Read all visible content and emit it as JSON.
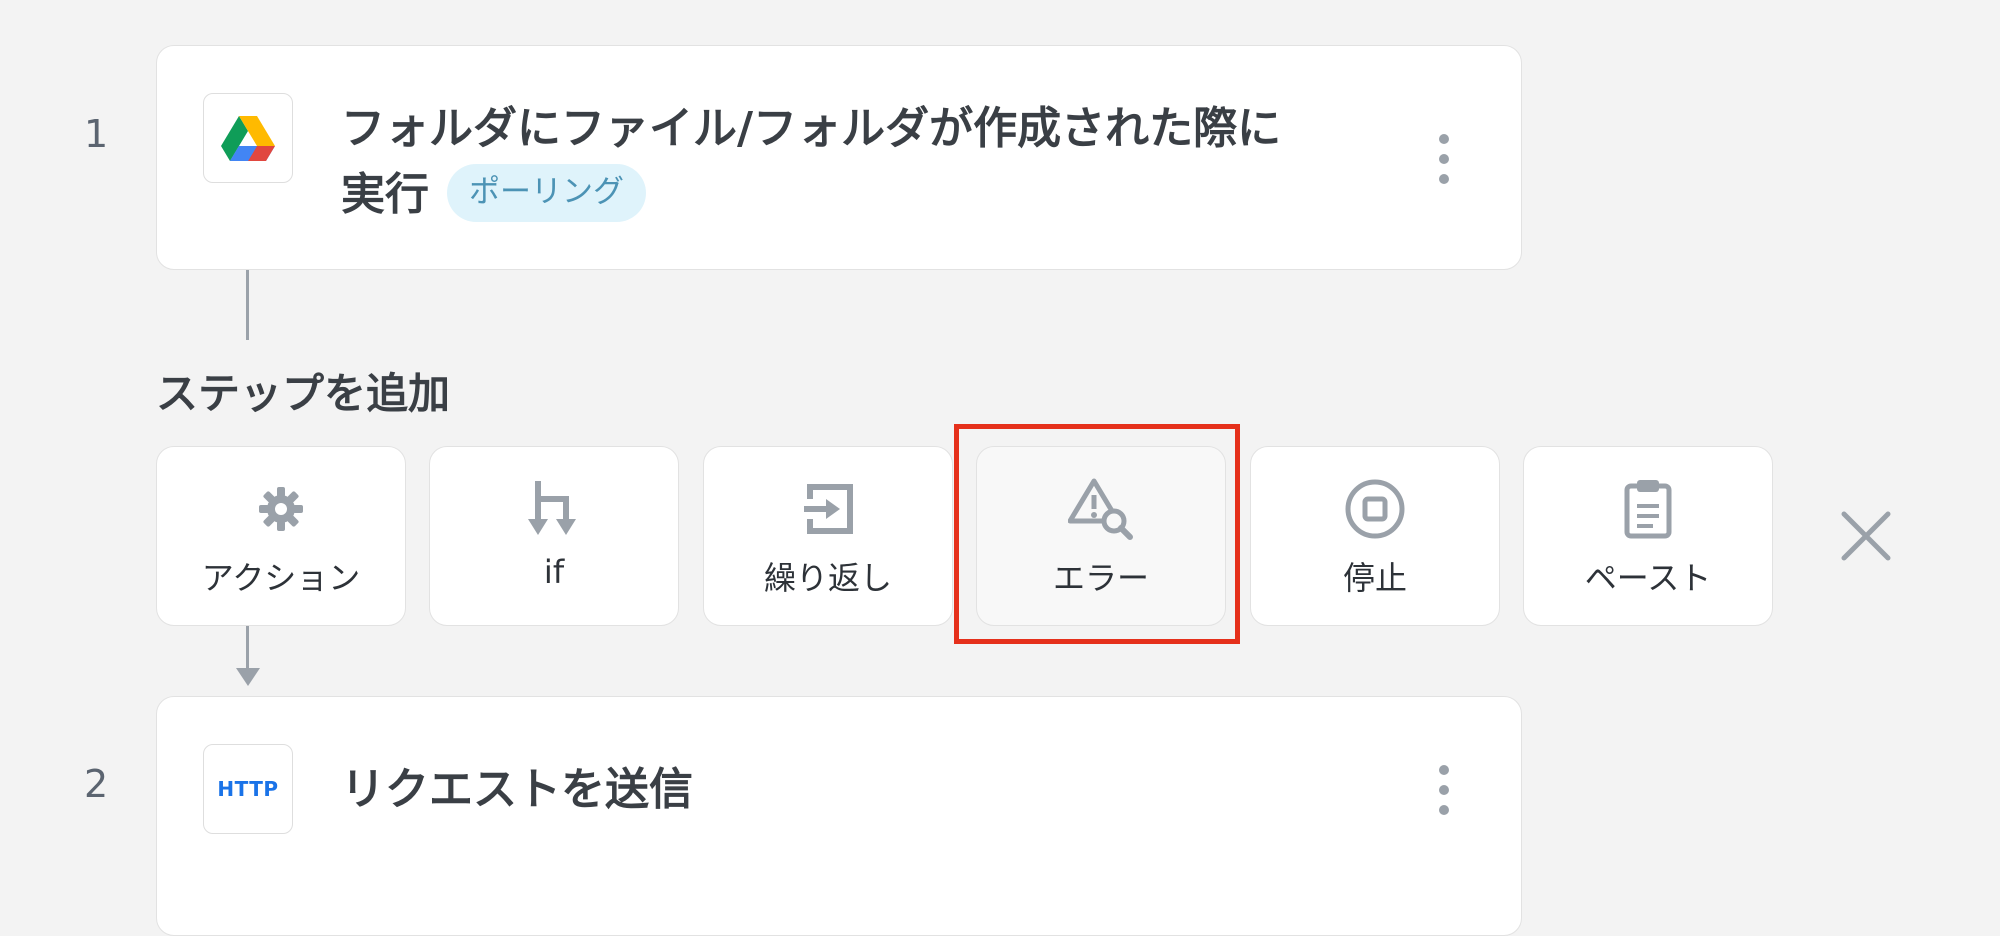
{
  "steps": [
    {
      "number": "1",
      "icon": "google-drive-icon",
      "title": "フォルダにファイル/フォルダが作成された際に実行",
      "badge": "ポーリング"
    },
    {
      "number": "2",
      "icon": "http-icon",
      "icon_text": "HTTP",
      "title": "リクエストを送信"
    }
  ],
  "add_step": {
    "title": "ステップを追加",
    "options": [
      {
        "label": "アクション",
        "icon": "gear-icon"
      },
      {
        "label": "if",
        "icon": "branch-icon"
      },
      {
        "label": "繰り返し",
        "icon": "loop-icon"
      },
      {
        "label": "エラー",
        "icon": "error-search-icon"
      },
      {
        "label": "停止",
        "icon": "stop-icon"
      },
      {
        "label": "ペースト",
        "icon": "clipboard-icon"
      }
    ],
    "close_icon": "close-icon"
  },
  "colors": {
    "background": "#f3f3f3",
    "card": "#ffffff",
    "icon_gray": "#9aa1a9",
    "badge_bg": "#dff3fb",
    "badge_text": "#4c93b5",
    "http_blue": "#1a73e8",
    "highlight": "#e5301b"
  }
}
